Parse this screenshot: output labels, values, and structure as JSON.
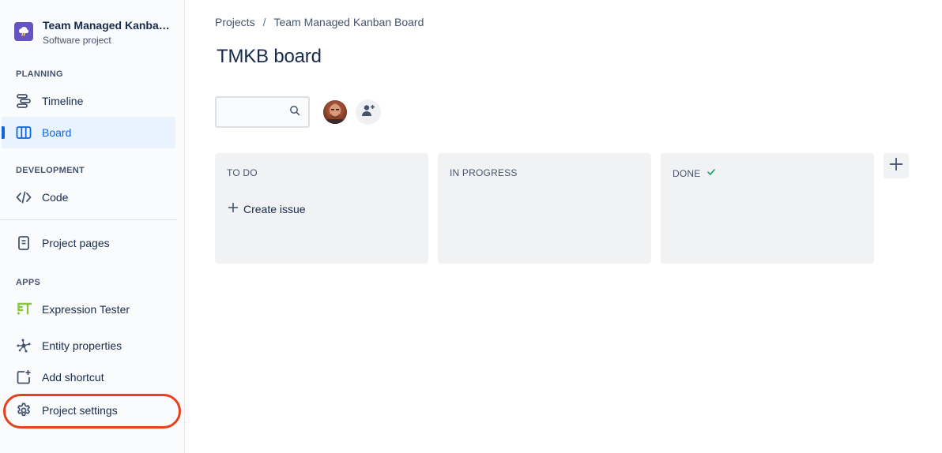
{
  "project": {
    "name": "Team Managed Kanban Board",
    "type": "Software project"
  },
  "sidebar": {
    "sections": {
      "planning": "PLANNING",
      "development": "DEVELOPMENT",
      "apps": "APPS"
    },
    "items": [
      {
        "label": "Timeline",
        "icon": "timeline-icon"
      },
      {
        "label": "Board",
        "icon": "board-icon",
        "active": true
      },
      {
        "label": "Code",
        "icon": "code-icon"
      },
      {
        "label": "Project pages",
        "icon": "page-icon"
      },
      {
        "label": "Expression Tester",
        "icon": "expression-tester-icon"
      },
      {
        "label": "Entity properties",
        "icon": "entity-properties-icon"
      },
      {
        "label": "Add shortcut",
        "icon": "add-shortcut-icon"
      },
      {
        "label": "Project settings",
        "icon": "gear-icon"
      }
    ]
  },
  "breadcrumb": {
    "root": "Projects",
    "separator": "/",
    "current": "Team Managed Kanban Board"
  },
  "board": {
    "title": "TMKB board",
    "search_placeholder": "",
    "columns": [
      {
        "title": "TO DO",
        "create_label": "Create issue"
      },
      {
        "title": "IN PROGRESS"
      },
      {
        "title": "DONE",
        "done": true
      }
    ]
  },
  "colors": {
    "accent": "#0c66e4",
    "highlight": "#e8401c",
    "done_check": "#22a06b",
    "expression_tester": "#8bc34a"
  }
}
